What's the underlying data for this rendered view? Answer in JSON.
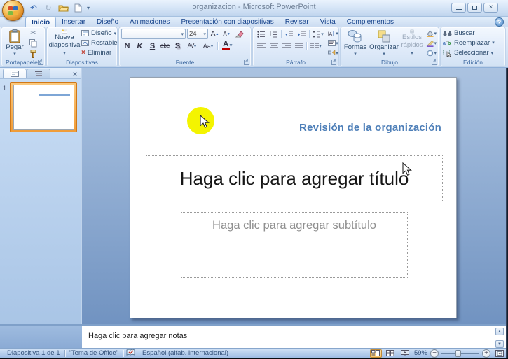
{
  "window": {
    "title": "organizacion - Microsoft PowerPoint"
  },
  "ribbon": {
    "tabs": [
      {
        "label": "Inicio",
        "active": true
      },
      {
        "label": "Insertar"
      },
      {
        "label": "Diseño"
      },
      {
        "label": "Animaciones"
      },
      {
        "label": "Presentación con diapositivas"
      },
      {
        "label": "Revisar"
      },
      {
        "label": "Vista"
      },
      {
        "label": "Complementos"
      }
    ],
    "clipboard": {
      "label": "Portapapeles",
      "paste": "Pegar"
    },
    "slides": {
      "label": "Diapositivas",
      "new_slide_line1": "Nueva",
      "new_slide_line2": "diapositiva",
      "design": "Diseño",
      "reset": "Restablecer",
      "delete": "Eliminar"
    },
    "font": {
      "label": "Fuente",
      "font_name": "",
      "font_size": "24",
      "bold": "N",
      "italic": "K",
      "underline": "S",
      "strikethrough": "abc",
      "shadow": "S",
      "char_spacing": "AV",
      "change_case": "Aa",
      "font_color": "A"
    },
    "paragraph": {
      "label": "Párrafo"
    },
    "drawing": {
      "label": "Dibujo",
      "shapes": "Formas",
      "arrange": "Organizar",
      "quick_styles_line1": "Estilos",
      "quick_styles_line2": "rápidos"
    },
    "editing": {
      "label": "Edición",
      "find": "Buscar",
      "replace": "Reemplazar",
      "select": "Seleccionar"
    }
  },
  "slides_panel": {
    "slide_number": "1"
  },
  "slide": {
    "heading": "Revisión de la organización",
    "title_placeholder": "Haga clic para agregar título",
    "subtitle_placeholder": "Haga clic para agregar subtítulo"
  },
  "notes": {
    "placeholder": "Haga clic para agregar notas"
  },
  "status_bar": {
    "slide_indicator": "Diapositiva 1 de 1",
    "theme": "\"Tema de Office\"",
    "language": "Español (alfab. internacional)",
    "zoom_level": "59%"
  },
  "glyphs": {
    "dropdown": "▾",
    "undo": "↶",
    "redo": "↻",
    "scissors": "✂",
    "close": "×",
    "help": "?",
    "up_arrow": "▲",
    "down_arrow": "▼"
  },
  "colors": {
    "accent_blue": "#4e7fb8",
    "highlight_yellow": "#f4f400",
    "selection_orange": "#f09c38",
    "font_color_swatch": "#c00000"
  }
}
